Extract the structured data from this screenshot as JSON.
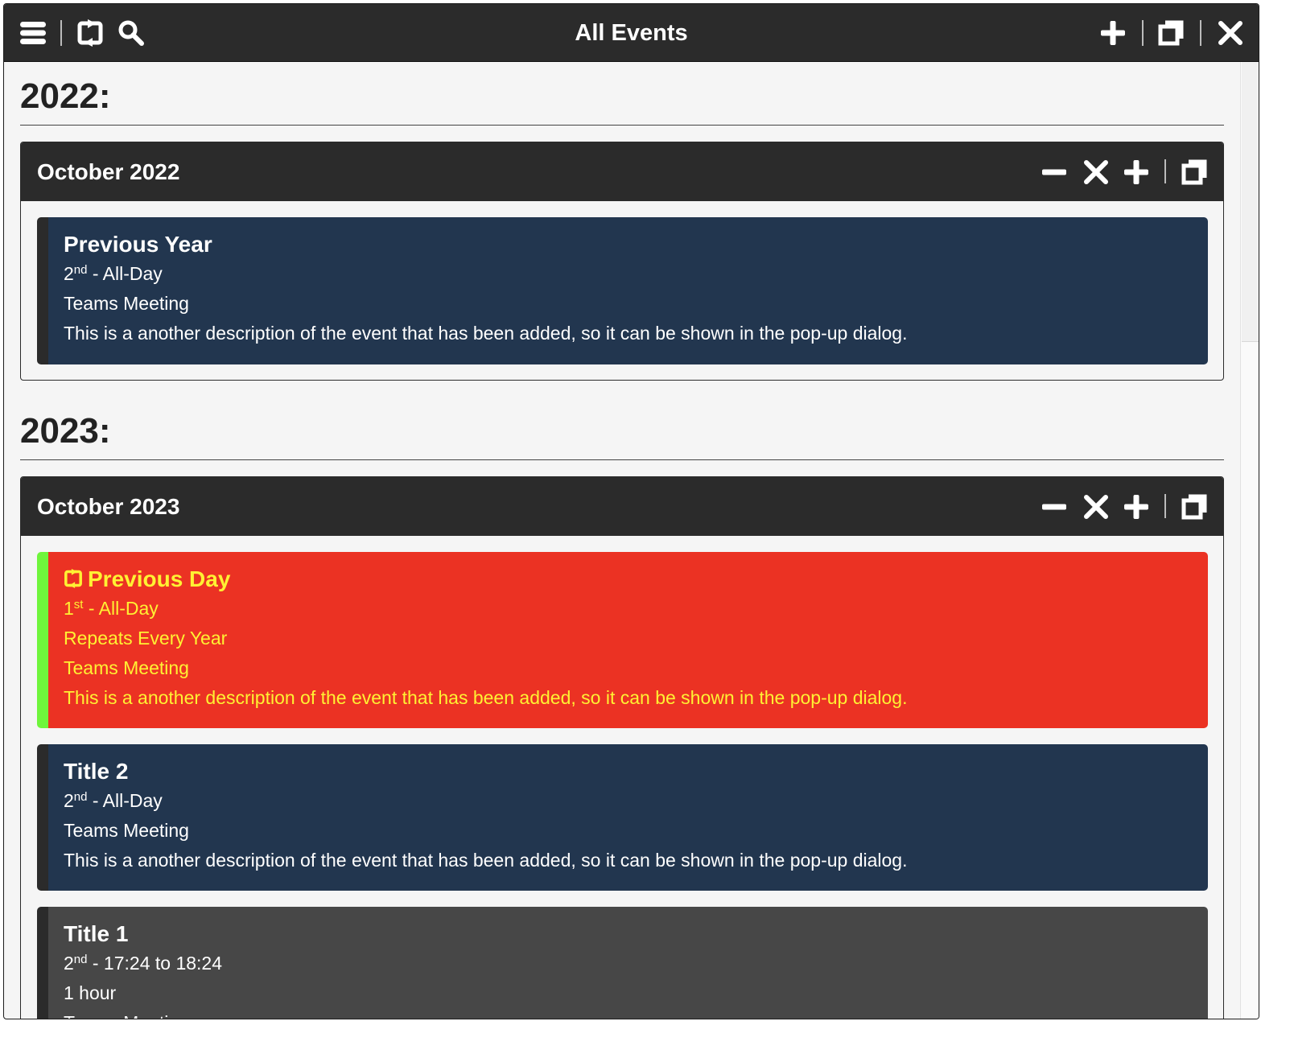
{
  "app": {
    "title": "All Events"
  },
  "toolbar": {
    "left_icons": [
      "menu-icon",
      "repeat-icon",
      "search-icon"
    ],
    "right_icons": [
      "plus-icon",
      "maximize-icon",
      "close-icon"
    ]
  },
  "years": [
    {
      "heading": "2022:",
      "months": [
        {
          "title": "October 2022",
          "events": [
            {
              "title": "Previous Year",
              "day": "2",
              "day_suffix": "nd",
              "time": " - All-Day",
              "lines": [
                "Teams Meeting",
                "This is a another description of the event that has been added, so it can be shown in the pop-up dialog."
              ]
            }
          ]
        }
      ]
    },
    {
      "heading": "2023:",
      "months": [
        {
          "title": "October 2023",
          "events": [
            {
              "title": "Previous Day",
              "repeating": true,
              "day": "1",
              "day_suffix": "st",
              "time": " - All-Day",
              "lines": [
                "Repeats Every Year",
                "Teams Meeting",
                "This is a another description of the event that has been added, so it can be shown in the pop-up dialog."
              ]
            },
            {
              "title": "Title 2",
              "day": "2",
              "day_suffix": "nd",
              "time": " - All-Day",
              "lines": [
                "Teams Meeting",
                "This is a another description of the event that has been added, so it can be shown in the pop-up dialog."
              ]
            },
            {
              "title": "Title 1",
              "day": "2",
              "day_suffix": "nd",
              "time": " - 17:24 to 18:24",
              "lines": [
                "1 hour",
                "Teams Meeting"
              ]
            }
          ]
        }
      ]
    }
  ],
  "colors": {
    "titlebar": "#2b2b2b",
    "event_navy": "#22364f",
    "event_red": "#eb3223",
    "event_red_text": "#fff133",
    "event_red_stripe": "#6ff53c",
    "event_grey": "#474747"
  }
}
